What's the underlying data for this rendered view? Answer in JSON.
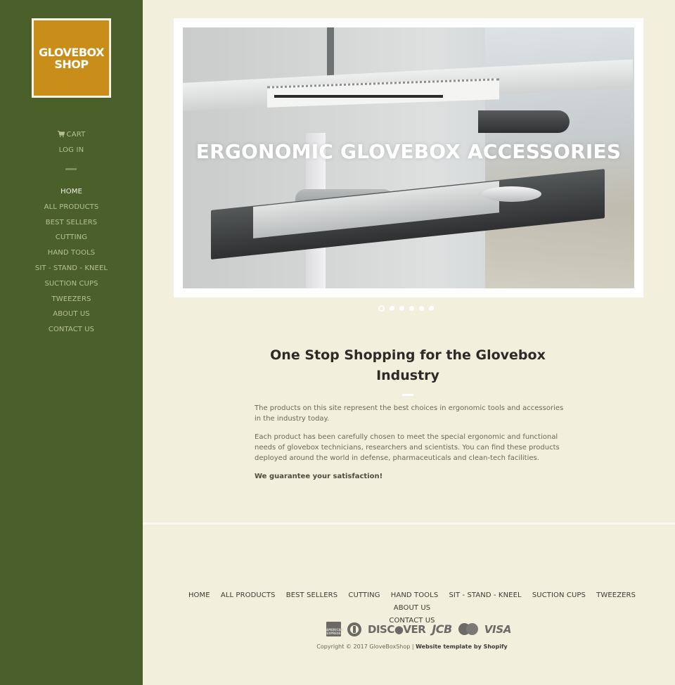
{
  "sidebar": {
    "logo": {
      "line1": "GLOVEBOX",
      "line2": "SHOP"
    },
    "cart_label": "CART",
    "login_label": "LOG IN",
    "nav": [
      {
        "label": "HOME",
        "active": true
      },
      {
        "label": "ALL PRODUCTS"
      },
      {
        "label": "BEST SELLERS"
      },
      {
        "label": "CUTTING"
      },
      {
        "label": "HAND TOOLS"
      },
      {
        "label": "SIT - STAND - KNEEL"
      },
      {
        "label": "SUCTION CUPS"
      },
      {
        "label": "TWEEZERS"
      },
      {
        "label": "ABOUT US"
      },
      {
        "label": "CONTACT US"
      }
    ]
  },
  "hero": {
    "title": "ERGONOMIC GLOVEBOX ACCESSORIES",
    "slide_count": 6,
    "active_slide": 1
  },
  "intro": {
    "heading": "One Stop Shopping for the Glovebox Industry",
    "paragraphs": [
      "The products on this site represent the best choices in ergonomic tools and accessories in the industry today.",
      "Each product has been carefully chosen to meet the special ergonomic and functional needs of glovebox technicians, researchers and scientists. You can find these products deployed around the world in defense, pharmaceuticals and clean-tech facilities."
    ],
    "guarantee": "We guarantee your satisfaction!"
  },
  "footer": {
    "nav": [
      "HOME",
      "ALL PRODUCTS",
      "BEST SELLERS",
      "CUTTING",
      "HAND TOOLS",
      "SIT - STAND - KNEEL",
      "SUCTION CUPS",
      "TWEEZERS",
      "ABOUT US",
      "CONTACT US"
    ],
    "payments": {
      "amex": "AMERICAN EXPRESS",
      "diners": "diners-club-icon",
      "discover": "DISC●VER",
      "jcb": "JCB",
      "mastercard": "mastercard-icon",
      "visa": "VISA"
    },
    "copyright": "Copyright © 2017 GloveBoxShop |",
    "template_credit": "Website template by Shopify"
  },
  "colors": {
    "sidebar_bg": "#4a5f29",
    "logo_bg": "#c98e1a",
    "page_bg": "#f2efdc",
    "nav_text": "#b6c290",
    "heading_text": "#2c2b26"
  }
}
